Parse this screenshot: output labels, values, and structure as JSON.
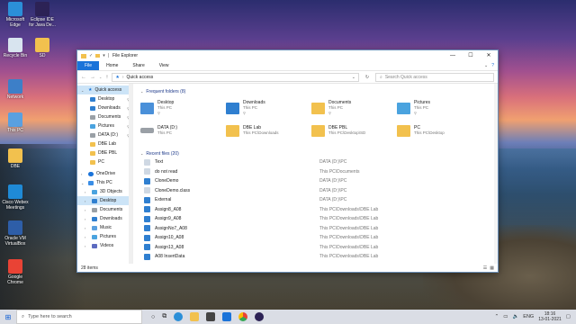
{
  "desktop": {
    "icons": [
      {
        "label": "Microsoft Edge",
        "icon": "edge-icon",
        "color": "#2b8fd8"
      },
      {
        "label": "Eclipse IDE for Java De...",
        "icon": "eclipse-icon",
        "color": "#2c2255"
      },
      {
        "label": "Recycle Bin",
        "icon": "recycle-bin-icon",
        "color": "#d8e4ef"
      },
      {
        "label": "SD",
        "icon": "folder-icon",
        "color": "#f2c14e"
      },
      {
        "label": "Network",
        "icon": "network-icon",
        "color": "#3d7fc8"
      },
      {
        "label": "This PC",
        "icon": "this-pc-icon",
        "color": "#5aa0e0"
      },
      {
        "label": "DBE",
        "icon": "folder-icon",
        "color": "#f2c14e"
      },
      {
        "label": "Cisco Webex Meetings",
        "icon": "webex-icon",
        "color": "#1f8ad6"
      },
      {
        "label": "Oracle VM VirtualBox",
        "icon": "virtualbox-icon",
        "color": "#2e5ea8"
      },
      {
        "label": "Google Chrome",
        "icon": "chrome-icon",
        "color": "#e94335"
      }
    ]
  },
  "explorer": {
    "title": "File Explorer",
    "ribbon_tabs": [
      "File",
      "Home",
      "Share",
      "View"
    ],
    "address": {
      "location": "Quick access",
      "search_placeholder": "Search Quick access"
    },
    "nav": {
      "quick_access": "Quick access",
      "quick_items": [
        {
          "label": "Desktop",
          "pinned": true
        },
        {
          "label": "Downloads",
          "pinned": true
        },
        {
          "label": "Documents",
          "pinned": true
        },
        {
          "label": "Pictures",
          "pinned": true
        },
        {
          "label": "DATA (D:)",
          "pinned": true
        },
        {
          "label": "DBE Lab",
          "pinned": false
        },
        {
          "label": "DBE PBL",
          "pinned": false
        },
        {
          "label": "PC",
          "pinned": false
        }
      ],
      "onedrive": "OneDrive",
      "this_pc": "This PC",
      "pc_items": [
        "3D Objects",
        "Desktop",
        "Documents",
        "Downloads",
        "Music",
        "Pictures",
        "Videos"
      ]
    },
    "frequent": {
      "header": "Frequent folders (8)",
      "folders": [
        {
          "name": "Desktop",
          "sub": "This PC",
          "pinned": true,
          "color": "#4a90d9"
        },
        {
          "name": "Downloads",
          "sub": "This PC",
          "pinned": true,
          "color": "#2f7fd0"
        },
        {
          "name": "Documents",
          "sub": "This PC",
          "pinned": true,
          "color": "#f2c14e"
        },
        {
          "name": "Pictures",
          "sub": "This PC",
          "pinned": true,
          "color": "#4aa3df"
        },
        {
          "name": "DATA (D:)",
          "sub": "This PC",
          "pinned": false,
          "color": "#9aa0a6"
        },
        {
          "name": "DBE Lab",
          "sub": "This PC\\Downloads",
          "pinned": false,
          "color": "#f2c14e"
        },
        {
          "name": "DBE PBL",
          "sub": "This PC\\Desktop\\SD",
          "pinned": false,
          "color": "#f2c14e"
        },
        {
          "name": "PC",
          "sub": "This PC\\Desktop",
          "pinned": false,
          "color": "#f2c14e"
        }
      ]
    },
    "recent": {
      "header": "Recent files (20)",
      "files": [
        {
          "name": "Text",
          "path": "DATA (D:)\\PC",
          "color": "#cfd8e3"
        },
        {
          "name": "do not read",
          "path": "This PC\\Documents",
          "color": "#cfd8e3"
        },
        {
          "name": "CloneDemo",
          "path": "DATA (D:)\\PC",
          "color": "#2f7fd0"
        },
        {
          "name": "CloneDemo.class",
          "path": "DATA (D:)\\PC",
          "color": "#cfd8e3"
        },
        {
          "name": "External",
          "path": "DATA (D:)\\PC",
          "color": "#2f7fd0"
        },
        {
          "name": "Assign8_A08",
          "path": "This PC\\Downloads\\DBE Lab",
          "color": "#2f7fd0"
        },
        {
          "name": "Assign9_A08",
          "path": "This PC\\Downloads\\DBE Lab",
          "color": "#2f7fd0"
        },
        {
          "name": "AssignNo7_A08",
          "path": "This PC\\Downloads\\DBE Lab",
          "color": "#2f7fd0"
        },
        {
          "name": "Assign10_A08",
          "path": "This PC\\Downloads\\DBE Lab",
          "color": "#2f7fd0"
        },
        {
          "name": "Assign13_A08",
          "path": "This PC\\Downloads\\DBE Lab",
          "color": "#2f7fd0"
        },
        {
          "name": "A08 InsertData",
          "path": "This PC\\Downloads\\DBE Lab",
          "color": "#2f7fd0"
        }
      ]
    },
    "status": "28 items"
  },
  "taskbar": {
    "search_placeholder": "Type here to search",
    "language": "ENG",
    "time": "18:16",
    "date": "13-01-2021"
  }
}
